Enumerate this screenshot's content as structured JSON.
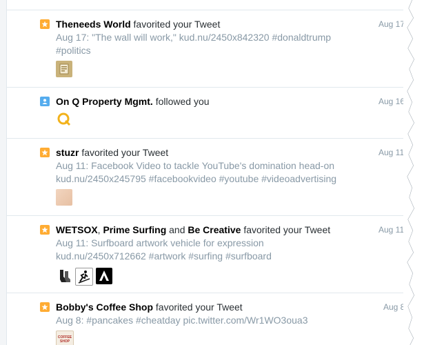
{
  "notifications": [
    {
      "type": "favorite",
      "actors": [
        "Theneeds World"
      ],
      "action": "favorited your Tweet",
      "date": "Aug 17",
      "tweet_line1": "Aug 17: \"The wall will work,\"  kud.nu/2450x842320 #donaldtrump",
      "tweet_line2": "#politics",
      "avatars": [
        "theneeds-avatar"
      ]
    },
    {
      "type": "follow",
      "actors": [
        "On Q Property Mgmt."
      ],
      "action": "followed you",
      "date": "Aug 16",
      "avatars": [
        "onq-avatar"
      ]
    },
    {
      "type": "favorite",
      "actors": [
        "stuzr"
      ],
      "action": "favorited your Tweet",
      "date": "Aug 11",
      "tweet_line1": "Aug 11: Facebook Video to tackle YouTube's domination head-on",
      "tweet_line2": "kud.nu/2450x245795 #facebookvideo #youtube #videoadvertising",
      "avatars": [
        "stuzr-avatar"
      ]
    },
    {
      "type": "favorite",
      "actors": [
        "WETSOX",
        "Prime Surfing",
        "Be Creative"
      ],
      "joiner": ",",
      "and": "and",
      "action": "favorited your Tweet",
      "date": "Aug 11",
      "tweet_line1": "Aug 11: Surfboard artwork vehicle for expression",
      "tweet_line2": "kud.nu/2450x712662 #artwork #surfing #surfboard",
      "avatars": [
        "wetsox-avatar",
        "prime-surfing-avatar",
        "be-creative-avatar"
      ]
    },
    {
      "type": "favorite",
      "actors": [
        "Bobby's Coffee Shop"
      ],
      "action": "favorited your Tweet",
      "date": "Aug 8",
      "tweet_line1": "Aug 8: #pancakes #cheatday pic.twitter.com/Wr1WO3oua3",
      "avatars": [
        "bobbys-coffee-avatar"
      ],
      "avatar_text": "COFFEE SHOP"
    }
  ],
  "colors": {
    "favorite_badge": "#ffac33",
    "follow_badge": "#55acee",
    "muted_text": "#8899a6",
    "name_text": "#000000"
  }
}
